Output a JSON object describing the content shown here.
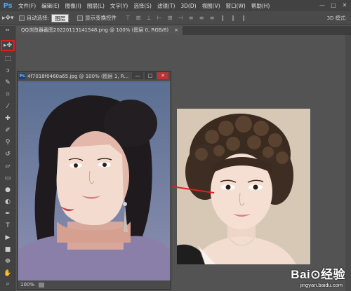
{
  "app": {
    "logo": "Ps"
  },
  "menu": {
    "items": [
      "文件(F)",
      "编辑(E)",
      "图像(I)",
      "图层(L)",
      "文字(Y)",
      "选择(S)",
      "滤镜(T)",
      "3D(D)",
      "视图(V)",
      "窗口(W)",
      "帮助(H)"
    ],
    "window_buttons": [
      "—",
      "□",
      "✕"
    ]
  },
  "options": {
    "auto_select_label": "自动选择:",
    "auto_select_value": "图层",
    "show_transform_label": "显示变换控件",
    "mode_3d": "3D 模式:"
  },
  "doc_tab": {
    "title": "QQ浏览器截图20220113141548.png @ 100% (图层 0, RGB/8)",
    "close": "×"
  },
  "float_window": {
    "title": "4f7018f0460a65.jpg @ 100% (图层 1, R...",
    "zoom": "100%"
  },
  "watermark": {
    "logo": "Bai⊙经验",
    "url": "jingyan.baidu.com"
  },
  "colors": {
    "accent_red": "#e02020",
    "arrow_red": "#e02020"
  }
}
